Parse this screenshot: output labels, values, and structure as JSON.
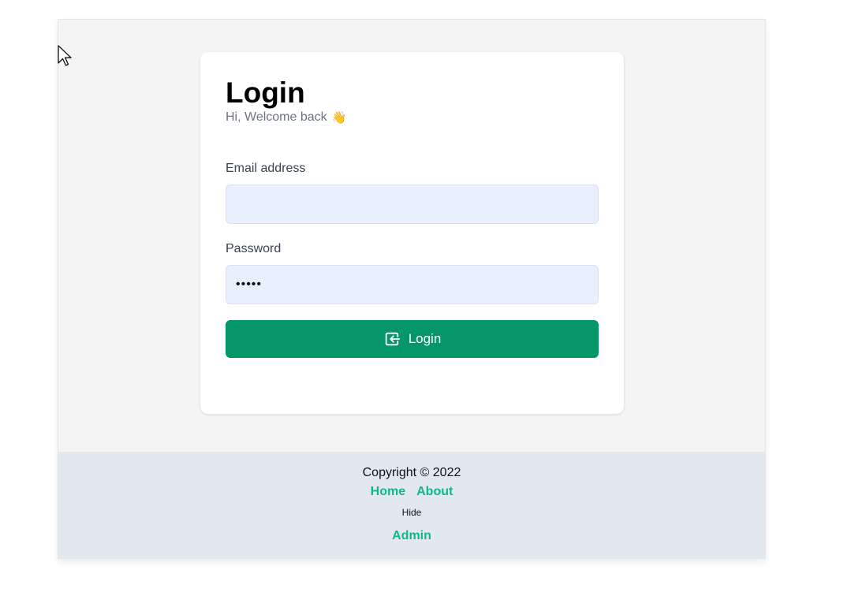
{
  "login": {
    "title": "Login",
    "subtitle": "Hi, Welcome back",
    "wave_emoji": "👋",
    "email_label": "Email address",
    "email_value": "",
    "password_label": "Password",
    "password_value": "•••••",
    "button_label": "Login"
  },
  "footer": {
    "copyright": "Copyright © 2022",
    "links": [
      "Home",
      "About"
    ],
    "hide_label": "Hide",
    "admin_label": "Admin"
  },
  "icons": {
    "login_button_icon": "login-icon",
    "cursor": "mouse-cursor-icon"
  },
  "colors": {
    "primary_button": "#059669",
    "link": "#10b981",
    "input_bg": "#e8f0fe",
    "footer_bg": "#e2e8f0"
  }
}
